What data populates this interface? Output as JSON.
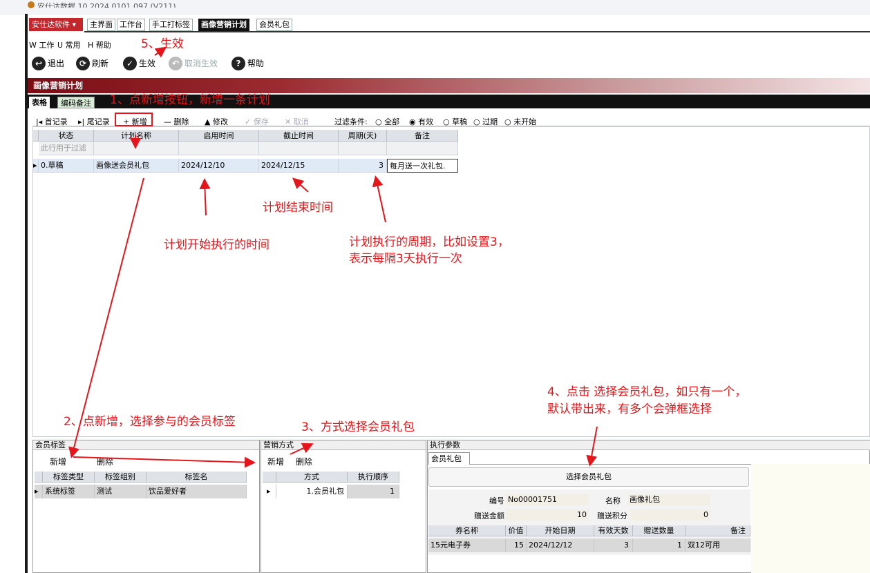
{
  "window": {
    "title": "安仕达数据 10.2024.0101.097 (V211)"
  },
  "brand_button": "安仕达软件 ▾",
  "tabs": [
    "主界面",
    "工作台",
    "手工打标签",
    "画像营销计划",
    "会员礼包"
  ],
  "menu": [
    "W 工作",
    "U 常用",
    "H 帮助"
  ],
  "toolbar": {
    "exit": "退出",
    "refresh": "刷新",
    "activate": "生效",
    "cancel_activate": "取消生效",
    "help": "帮助"
  },
  "banner_title": "画像营销计划",
  "subtabs": [
    "表格",
    "编码备注"
  ],
  "grid_toolbar": {
    "first": "|◂ 首记录",
    "last": "▸| 尾记录",
    "add": "+ 新增",
    "delete": "— 删除",
    "edit": "▲ 修改",
    "save": "✓ 保存",
    "cancel": "✕ 取消",
    "filter_label": "过滤条件:",
    "filters": [
      "全部",
      "有效",
      "草稿",
      "过期",
      "未开始"
    ],
    "filter_selected": "有效"
  },
  "plan_grid": {
    "headers": [
      "状态",
      "计划名称",
      "启用时间",
      "截止时间",
      "周期(天)",
      "备注"
    ],
    "filter_hint": "此行用于过滤",
    "rows": [
      [
        "0.草稿",
        "画像送会员礼包",
        "2024/12/10",
        "2024/12/15",
        "3",
        "每月送一次礼包."
      ]
    ]
  },
  "member_tags_panel": {
    "title": "会员标签",
    "add": "新增",
    "delete": "删除",
    "headers": [
      "标签类型",
      "标签组别",
      "标签名"
    ],
    "rows": [
      [
        "系统标签",
        "测试",
        "饮品爱好者"
      ]
    ]
  },
  "marketing_panel": {
    "title": "营销方式",
    "add": "新增",
    "delete": "删除",
    "headers": [
      "方式",
      "执行顺序"
    ],
    "rows": [
      [
        "1.会员礼包",
        "1"
      ]
    ]
  },
  "exec_panel": {
    "title": "执行参数",
    "tab": "会员礼包",
    "select_button": "选择会员礼包",
    "fields": {
      "code_label": "编号",
      "code_value": "No00001751",
      "name_label": "名称",
      "name_value": "画像礼包",
      "amount_label": "赠送金额",
      "amount_value": "10",
      "points_label": "赠送积分",
      "points_value": "0"
    },
    "coupon_headers": [
      "券名称",
      "价值",
      "开始日期",
      "有效天数",
      "赠送数量",
      "备注"
    ],
    "coupon_rows": [
      [
        "15元电子券",
        "15",
        "2024/12/12",
        "3",
        "1",
        "双12可用"
      ]
    ]
  },
  "annotations": {
    "a1": "1、点新增按钮，新增一条计划",
    "a2": "2、点新增，选择参与的会员标签",
    "a3": "3、方式选择会员礼包",
    "a4_line1": "4、点击 选择会员礼包，如只有一个，",
    "a4_line2": "默认带出来，有多个会弹框选择",
    "a5": "5、生效",
    "start_time": "计划开始执行的时间",
    "end_time": "计划结束时间",
    "period_line1": "计划执行的周期，比如设置3，",
    "period_line2": "表示每隔3天执行一次"
  },
  "colors": {
    "annotation": "#e4161b",
    "brand": "#c1272d",
    "banner": "#7a0d14"
  }
}
